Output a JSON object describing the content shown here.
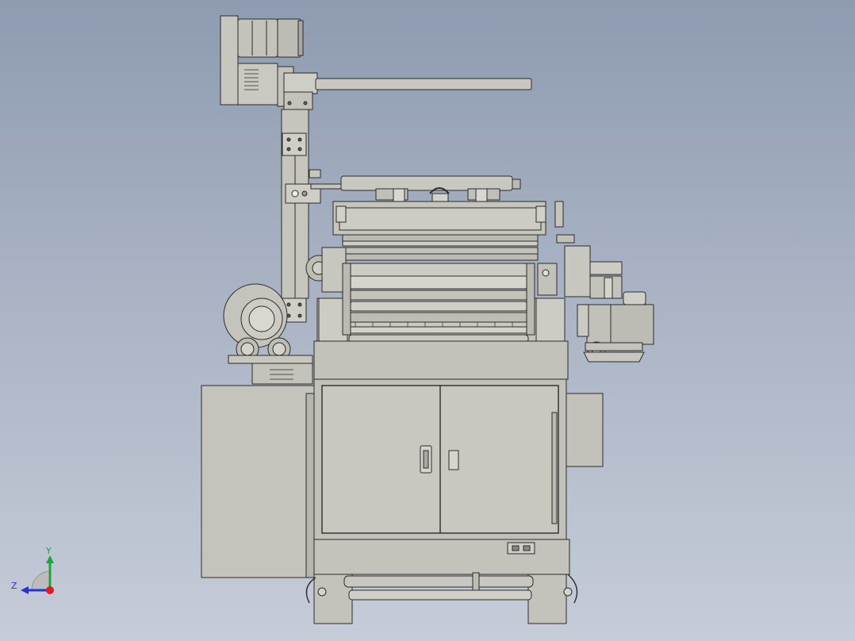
{
  "viewport": {
    "background_top": "#8e9bb0",
    "background_bottom": "#c6ccd8"
  },
  "model": {
    "body_color": "#c2c1b9",
    "body_light": "#d3d2ca",
    "body_dark": "#a9a8a0",
    "edge_color": "#2b2b2b",
    "shaft_color": "#b9b8b0"
  },
  "triad": {
    "y_label": "Y",
    "z_label": "Z",
    "x_color": "#e0182a",
    "y_color": "#1aa832",
    "z_color": "#2234d4"
  }
}
